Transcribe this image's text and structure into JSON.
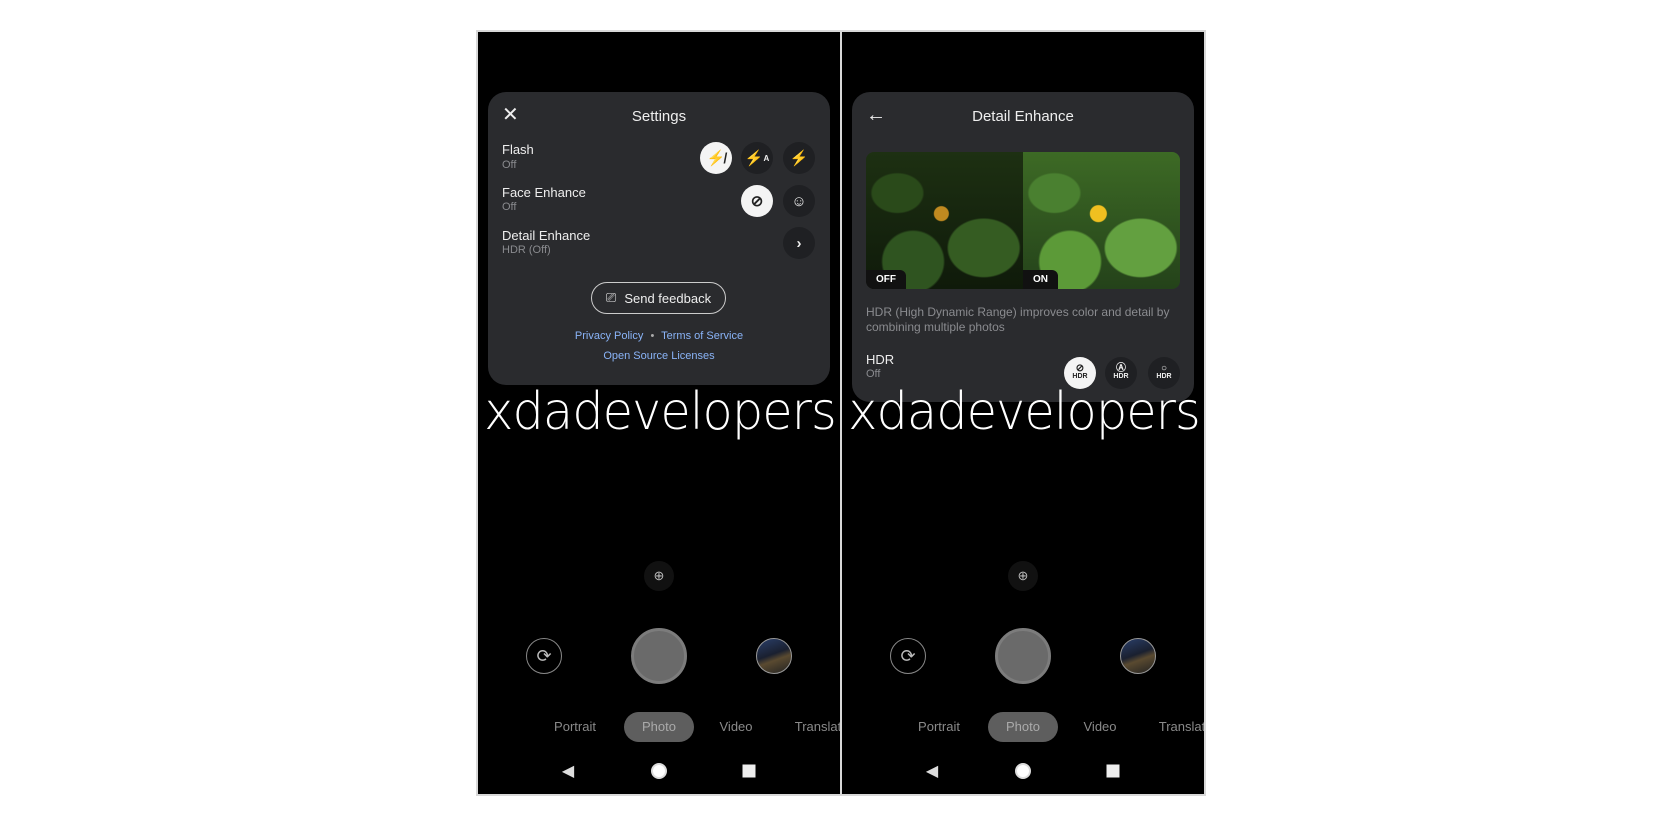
{
  "left": {
    "title": "Settings",
    "close_icon": "close-icon",
    "rows": [
      {
        "label": "Flash",
        "value": "Off",
        "options": [
          "flash-off-icon",
          "flash-auto-icon",
          "flash-on-icon"
        ],
        "selected": 0
      },
      {
        "label": "Face Enhance",
        "value": "Off",
        "options": [
          "face-enhance-off-icon",
          "face-enhance-on-icon"
        ],
        "selected": 0
      },
      {
        "label": "Detail Enhance",
        "value": "HDR (Off)"
      }
    ],
    "feedback_label": "Send feedback",
    "privacy": "Privacy Policy",
    "separator": "•",
    "terms": "Terms of Service",
    "licenses": "Open Source Licenses"
  },
  "right": {
    "title": "Detail Enhance",
    "off_tag": "OFF",
    "on_tag": "ON",
    "description": "HDR (High Dynamic Range) improves color and detail by combining multiple photos",
    "hdr_label": "HDR",
    "hdr_value": "Off",
    "hdr_option_text": "HDR",
    "hdr_options": [
      "hdr-off-icon",
      "hdr-auto-icon",
      "hdr-on-icon"
    ],
    "hdr_selected": 0
  },
  "watermark": "xdadevelopers",
  "modes": [
    "Portrait",
    "Photo",
    "Video",
    "Translat"
  ],
  "selected_mode": "Photo",
  "colors": {
    "panel": "#2a2b2e",
    "link": "#8ab4f8",
    "background": "#000000"
  }
}
